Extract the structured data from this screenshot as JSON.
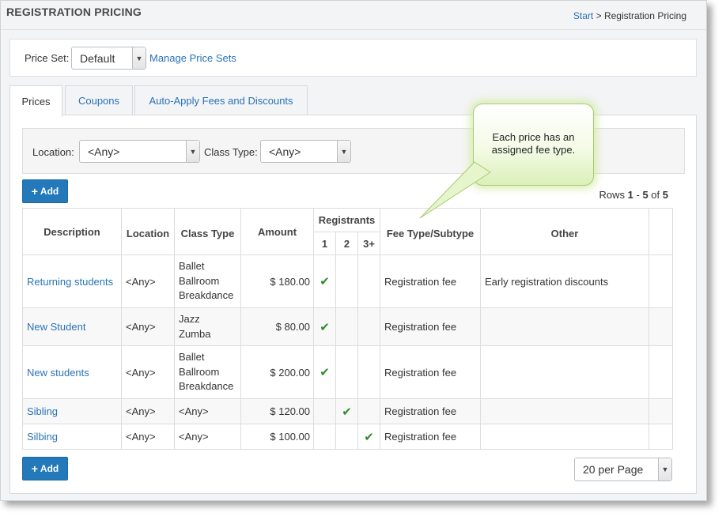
{
  "header": {
    "title": "REGISTRATION PRICING",
    "breadcrumb_start": "Start",
    "breadcrumb_sep": ">",
    "breadcrumb_current": "Registration Pricing"
  },
  "price_set": {
    "label": "Price Set:",
    "value": "Default",
    "manage_link": "Manage Price Sets"
  },
  "tabs": [
    {
      "label": "Prices",
      "active": true
    },
    {
      "label": "Coupons",
      "active": false
    },
    {
      "label": "Auto-Apply Fees and Discounts",
      "active": false
    }
  ],
  "filters": {
    "location_label": "Location:",
    "location_value": "<Any>",
    "class_type_label": "Class Type:",
    "class_type_value": "<Any>"
  },
  "add_label": "Add",
  "rows_info": {
    "prefix": "Rows",
    "from": "1",
    "dash": "-",
    "to": "5",
    "of": "of",
    "total": "5"
  },
  "table": {
    "headers": {
      "description": "Description",
      "location": "Location",
      "class_type": "Class Type",
      "amount": "Amount",
      "registrants": "Registrants",
      "reg1": "1",
      "reg2": "2",
      "reg3": "3+",
      "fee_type": "Fee Type/Subtype",
      "other": "Other"
    },
    "rows": [
      {
        "description": "Returning students",
        "location": "<Any>",
        "class_types": [
          "Ballet",
          "Ballroom",
          "Breakdance"
        ],
        "amount": "$ 180.00",
        "registrants": 1,
        "fee_type": "Registration fee",
        "other": "Early registration discounts"
      },
      {
        "description": "New Student",
        "location": "<Any>",
        "class_types": [
          "Jazz",
          "Zumba"
        ],
        "amount": "$ 80.00",
        "registrants": 1,
        "fee_type": "Registration fee",
        "other": ""
      },
      {
        "description": "New students",
        "location": "<Any>",
        "class_types": [
          "Ballet",
          "Ballroom",
          "Breakdance"
        ],
        "amount": "$ 200.00",
        "registrants": 1,
        "fee_type": "Registration fee",
        "other": ""
      },
      {
        "description": "Sibling",
        "location": "<Any>",
        "class_types": [
          "<Any>"
        ],
        "amount": "$ 120.00",
        "registrants": 2,
        "fee_type": "Registration fee",
        "other": ""
      },
      {
        "description": "Silbing",
        "location": "<Any>",
        "class_types": [
          "<Any>"
        ],
        "amount": "$ 100.00",
        "registrants": 3,
        "fee_type": "Registration fee",
        "other": ""
      }
    ]
  },
  "per_page": "20 per Page",
  "callout": {
    "line1": "Each price has an",
    "line2": "assigned fee type."
  },
  "icons": {
    "add": "plus-icon",
    "dropdown": "chevron-down-icon",
    "check": "checkmark-icon"
  },
  "colors": {
    "link": "#2a73b6",
    "button": "#2379b9",
    "check": "#2e8b2e",
    "callout_border": "#a8cc70"
  }
}
